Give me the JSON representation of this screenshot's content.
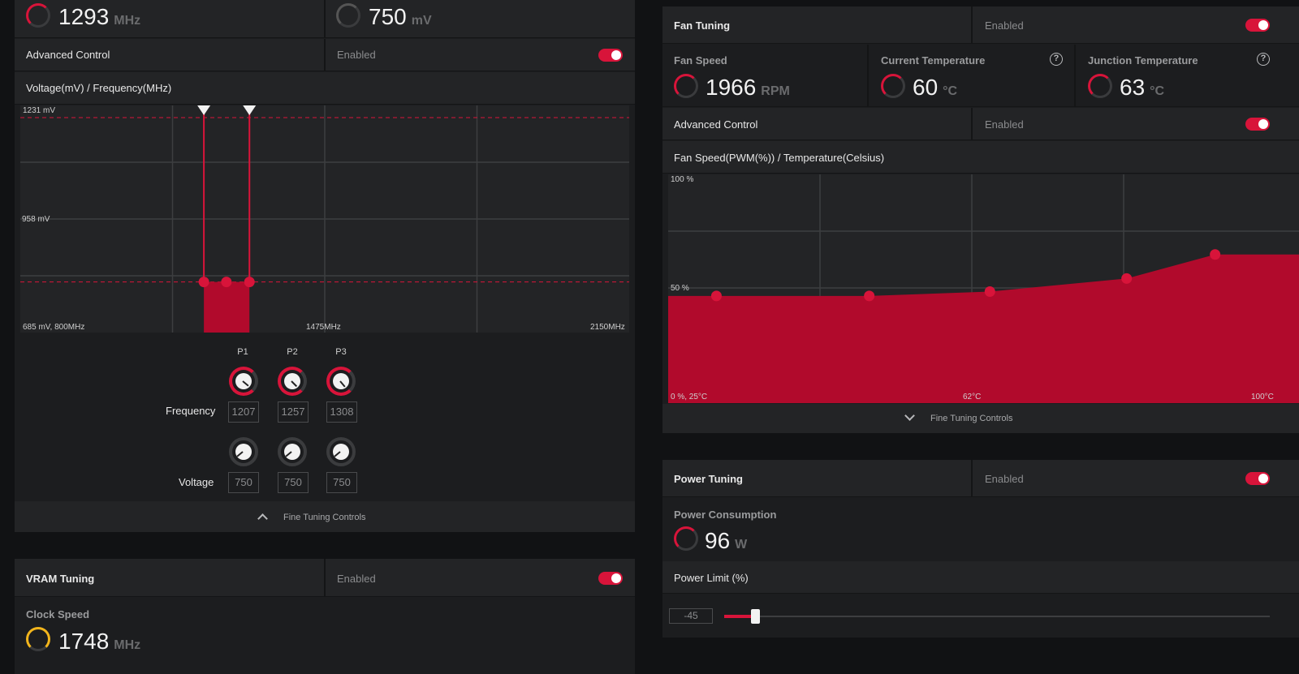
{
  "gpu": {
    "clock_value": "1293",
    "clock_unit": "MHz",
    "voltage_value": "750",
    "voltage_unit": "mV",
    "advanced_control_label": "Advanced Control",
    "advanced_control_state": "Enabled",
    "curve_title": "Voltage(mV) / Frequency(MHz)",
    "chart_labels": {
      "y_top": "1231 mV",
      "y_mid": "958 mV",
      "origin": "685 mV, 800MHz",
      "x_mid": "1475MHz",
      "x_max": "2150MHz"
    },
    "points": [
      {
        "name": "P1",
        "frequency": "1207",
        "voltage": "750"
      },
      {
        "name": "P2",
        "frequency": "1257",
        "voltage": "750"
      },
      {
        "name": "P3",
        "frequency": "1308",
        "voltage": "750"
      }
    ],
    "frequency_label": "Frequency",
    "voltage_label": "Voltage",
    "fine_tuning_label": "Fine Tuning Controls"
  },
  "vram": {
    "title": "VRAM Tuning",
    "state": "Enabled",
    "clock_speed_label": "Clock Speed",
    "clock_value": "1748",
    "clock_unit": "MHz"
  },
  "fan": {
    "title": "Fan Tuning",
    "state": "Enabled",
    "fan_speed_label": "Fan Speed",
    "fan_speed_value": "1966",
    "fan_speed_unit": "RPM",
    "current_temp_label": "Current Temperature",
    "current_temp_value": "60",
    "current_temp_unit": "°C",
    "junction_temp_label": "Junction Temperature",
    "junction_temp_value": "63",
    "junction_temp_unit": "°C",
    "help_glyph": "?",
    "advanced_control_label": "Advanced Control",
    "advanced_control_state": "Enabled",
    "curve_title": "Fan Speed(PWM(%)) / Temperature(Celsius)",
    "chart_labels": {
      "y_top": "100 %",
      "y_mid": "50 %",
      "origin": "0 %, 25°C",
      "x_mid": "62°C",
      "x_max": "100°C"
    },
    "fine_tuning_label": "Fine Tuning Controls"
  },
  "power": {
    "title": "Power Tuning",
    "state": "Enabled",
    "consumption_label": "Power Consumption",
    "consumption_value": "96",
    "consumption_unit": "W",
    "limit_label": "Power Limit (%)",
    "limit_value": "-45"
  },
  "colors": {
    "accent": "#d8143a",
    "panel": "#1c1d1f",
    "row": "#232426",
    "background": "#111214",
    "gauge_yellow": "#f2b51c"
  },
  "chart_data": [
    {
      "type": "line",
      "title": "Voltage(mV) / Frequency(MHz)",
      "xlabel": "",
      "ylabel": "",
      "x_unit": "MHz",
      "y_unit": "mV",
      "xlim": [
        800,
        2150
      ],
      "ylim": [
        685,
        1231
      ],
      "x_ticks": [
        800,
        1475,
        2150
      ],
      "y_ticks": [
        685,
        958,
        1231
      ],
      "grid": true,
      "series": [
        {
          "x": [
            1207,
            1257,
            1308
          ],
          "y": [
            750,
            750,
            750
          ]
        }
      ],
      "limit_line_mv": 1231
    },
    {
      "type": "area",
      "title": "Fan Speed(PWM(%)) / Temperature(Celsius)",
      "xlabel": "",
      "ylabel": "",
      "x_unit": "°C",
      "y_unit": "%",
      "xlim": [
        25,
        100
      ],
      "ylim": [
        0,
        100
      ],
      "x_ticks": [
        25,
        62,
        100
      ],
      "y_ticks": [
        0,
        50,
        100
      ],
      "grid": true,
      "series": [
        {
          "x": [
            25,
            31,
            50,
            65,
            82,
            93,
            100
          ],
          "y": [
            48,
            48,
            48,
            50,
            56,
            67,
            67
          ]
        }
      ],
      "control_points": [
        {
          "x": 31,
          "y": 48
        },
        {
          "x": 50,
          "y": 48
        },
        {
          "x": 65,
          "y": 50
        },
        {
          "x": 82,
          "y": 56
        },
        {
          "x": 93,
          "y": 67
        }
      ]
    }
  ]
}
